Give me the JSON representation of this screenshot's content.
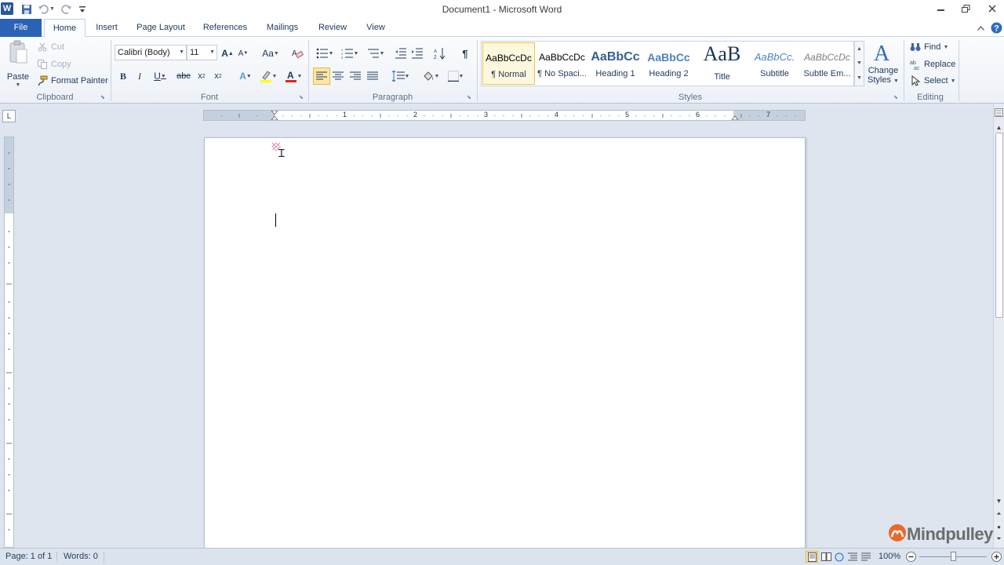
{
  "window": {
    "title": "Document1  -  Microsoft Word"
  },
  "tabs": [
    "File",
    "Home",
    "Insert",
    "Page Layout",
    "References",
    "Mailings",
    "Review",
    "View"
  ],
  "clipboard": {
    "paste": "Paste",
    "cut": "Cut",
    "copy": "Copy",
    "format_painter": "Format Painter",
    "label": "Clipboard"
  },
  "font": {
    "name": "Calibri (Body)",
    "size": "11",
    "label": "Font"
  },
  "paragraph": {
    "label": "Paragraph"
  },
  "styles": {
    "label": "Styles",
    "items": [
      {
        "preview": "AaBbCcDc",
        "name": "¶ Normal"
      },
      {
        "preview": "AaBbCcDc",
        "name": "¶ No Spaci..."
      },
      {
        "preview": "AaBbCc",
        "name": "Heading 1"
      },
      {
        "preview": "AaBbCc",
        "name": "Heading 2"
      },
      {
        "preview": "AaB",
        "name": "Title"
      },
      {
        "preview": "AaBbCc.",
        "name": "Subtitle"
      },
      {
        "preview": "AaBbCcDc",
        "name": "Subtle Em..."
      }
    ],
    "change_styles_line1": "Change",
    "change_styles_line2": "Styles"
  },
  "editing": {
    "find": "Find",
    "replace": "Replace",
    "select": "Select",
    "label": "Editing"
  },
  "ruler": {
    "numbers": [
      "1",
      "2",
      "3",
      "4",
      "5",
      "6",
      "7"
    ],
    "tab_selector": "L"
  },
  "status": {
    "page": "Page: 1 of 1",
    "words": "Words: 0",
    "zoom": "100%"
  },
  "watermark": {
    "text": "Mindpulley"
  },
  "colors": {
    "file_tab": "#2a62b5",
    "accent": "#1e395b",
    "selected_style": "#f0c340",
    "font_color_bar": "#e0241f",
    "highlight_bar": "#ffff00"
  }
}
